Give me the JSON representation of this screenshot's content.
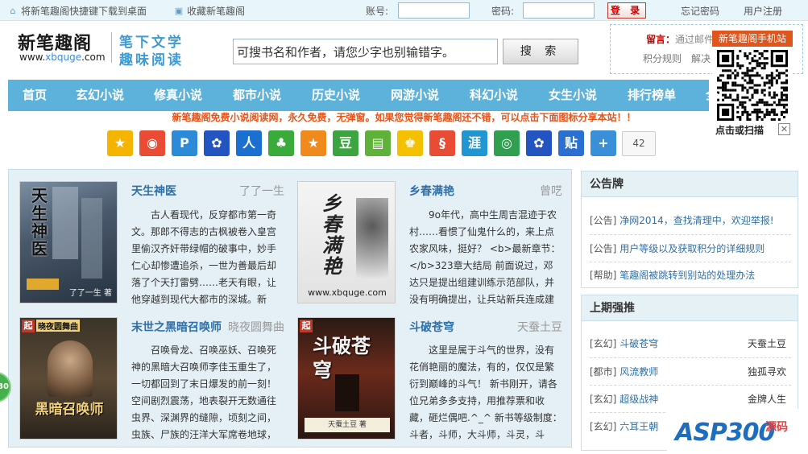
{
  "topbar": {
    "shortcut_link": "将新笔趣阁快捷键下载到桌面",
    "favorite_link": "收藏新笔趣阁",
    "account_label": "账号:",
    "password_label": "密码:",
    "login_button": "登 录",
    "forgot_password": "忘记密码",
    "register": "用户注册"
  },
  "header": {
    "logo_cn": "新笔趣阁",
    "logo_url_prefix": "www.",
    "logo_url_hl": "xbquge",
    "logo_url_suffix": ".com",
    "slogan_line1": "笔下文学",
    "slogan_line2": "趣味阅读",
    "search_value": "可搜书名和作者，请您少字也别输错字。",
    "search_button": "搜 索",
    "notice_label": "留言：",
    "notice_text": "通过邮件",
    "score_rules": "积分规则",
    "faq": "解决"
  },
  "mobile": {
    "title": "新笔趣阁手机站",
    "caption": "点击或扫描",
    "close": "✕"
  },
  "nav": {
    "items": [
      {
        "label": "首页"
      },
      {
        "label": "玄幻小说"
      },
      {
        "label": "修真小说"
      },
      {
        "label": "都市小说"
      },
      {
        "label": "历史小说"
      },
      {
        "label": "网游小说"
      },
      {
        "label": "科幻小说"
      },
      {
        "label": "女生小说"
      },
      {
        "label": "排行榜单"
      },
      {
        "label": "全"
      }
    ]
  },
  "announcement": "新笔趣阁免费小说阅读网，永久免费，无弹窗。如果您觉得新笔趣阁还不错，可以点击下面图标分享本站！！",
  "share": {
    "icons": [
      {
        "glyph": "★",
        "color": "#f4b400",
        "name": "qzone"
      },
      {
        "glyph": "◉",
        "color": "#e94b35",
        "name": "weibo"
      },
      {
        "glyph": "P",
        "color": "#2c8ad8",
        "name": "tencent-weibo"
      },
      {
        "glyph": "✿",
        "color": "#2454c2",
        "name": "baidu"
      },
      {
        "glyph": "人",
        "color": "#1b6fd1",
        "name": "renren"
      },
      {
        "glyph": "♣",
        "color": "#3aab3a",
        "name": "kaixin"
      },
      {
        "glyph": "★",
        "color": "#f08a1c",
        "name": "douban-star"
      },
      {
        "glyph": "豆",
        "color": "#3ca440",
        "name": "douban"
      },
      {
        "glyph": "▤",
        "color": "#5fb13a",
        "name": "bookmark"
      },
      {
        "glyph": "♚",
        "color": "#f5c000",
        "name": "qq"
      },
      {
        "glyph": "§",
        "color": "#e94b35",
        "name": "sohu"
      },
      {
        "glyph": "涯",
        "color": "#2196d3",
        "name": "tianya"
      },
      {
        "glyph": "◎",
        "color": "#30a050",
        "name": "netease"
      },
      {
        "glyph": "✿",
        "color": "#2454c2",
        "name": "baidu-hi"
      },
      {
        "glyph": "贴",
        "color": "#2b6fd0",
        "name": "tieba"
      },
      {
        "glyph": "+",
        "color": "#3a8fd9",
        "name": "more"
      }
    ],
    "count": "42"
  },
  "books": [
    {
      "title": "天生神医",
      "author": "了了一生",
      "desc": "古人看现代，反穿都市第一奇文。那郎不得志的古枫被卷入皇宫里偷汉齐奸带绿帽的破事中，妙手仁心却惨遭追杀，一世为善最后却落了个天打雷劈……老天有眼，让他穿越到现代大都市的深城。新",
      "cover_text": "天生神医",
      "cover_sub": "了了一生 著"
    },
    {
      "title": "乡春满艳",
      "author": "曾呓",
      "desc": "9o年代，高中生周吉混迹于农村……看惯了仙鬼什么的，来上点农家风味，挺好？ <b>最新章节：</b>323章大结局 前面说过，邓达只是提出组建训练示范部队，并没有明确提出，让兵站新兵连成建制",
      "cover_text": "乡春满艳",
      "cover_sub": "www.xbquge.com"
    },
    {
      "title": "末世之黑暗召唤师",
      "author": "晓夜圆舞曲",
      "desc": "召唤骨龙、召唤巫妖、召唤死神的黑暗大召唤师李佳玉重生了，一切都回到了末日爆发的前一刻！空间剧烈震荡，地表裂开无数通往虫界、深渊界的缝隙，顷刻之间，虫族、尸族的汪洋大军席卷地球，",
      "cover_text": "黑暗召唤师",
      "cover_sub": "晓夜圆舞曲"
    },
    {
      "title": "斗破苍穹",
      "author": "天蚕土豆",
      "desc": "这里是属于斗气的世界，没有花俏艳丽的魔法，有的，仅仅是繁衍到巅峰的斗气！ 新书刚开，请各位兄弟多多支持，用推荐票和收藏，砸烂偶吧.^_^ 新书等级制度：斗者，斗师，大斗师，斗灵，斗",
      "cover_text": "斗破苍穹",
      "cover_sub": "天蚕土豆 著"
    }
  ],
  "sidebar": {
    "notice_title": "公告牌",
    "notices": [
      {
        "tag": "[公告]",
        "text": "净网2014，查找清理中，欢迎举报!"
      },
      {
        "tag": "[公告]",
        "text": "用户等级以及获取积分的详细规则"
      },
      {
        "tag": "[帮助]",
        "text": "笔趣阁被跳转到别站的处理办法"
      }
    ],
    "rank_title": "上期强推",
    "ranks": [
      {
        "tag": "[玄幻]",
        "title": "斗破苍穹",
        "author": "天蚕土豆"
      },
      {
        "tag": "[都市]",
        "title": "风流教师",
        "author": "独孤寻欢"
      },
      {
        "tag": "[玄幻]",
        "title": "超级战神",
        "author": "金牌人生"
      },
      {
        "tag": "[玄幻]",
        "title": "六耳王朝",
        "author": ""
      }
    ]
  },
  "float_button": "30",
  "watermark": {
    "main": "ASP300",
    "sub": "源码"
  }
}
